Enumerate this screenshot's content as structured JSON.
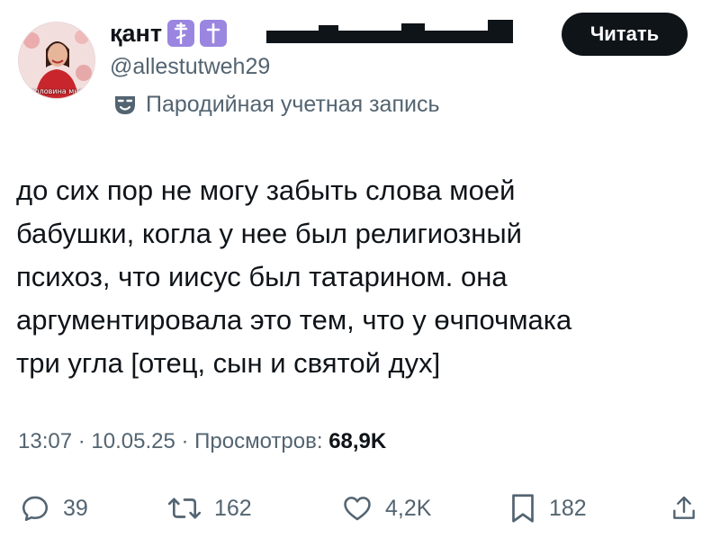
{
  "author": {
    "display_name": "қант",
    "handle": "@allestutweh29",
    "avatar_caption": "половина мне",
    "badge_icons": [
      "orthodox-cross-icon",
      "latin-cross-icon"
    ]
  },
  "parody_label": "Пародийная учетная запись",
  "follow_button": "Читать",
  "tweet": {
    "text": "до сих пор не могу забыть слова моей\nбабушки, когла у нее был религиозный\nпсихоз, что иисус был татарином. она\nаргументировала это тем, что у өчпочмака\nтри угла [отец, сын и святой дух]"
  },
  "meta": {
    "time": "13:07",
    "separator": " · ",
    "date": "10.05.25",
    "views_label": "Просмотров:",
    "views_value": "68,9K"
  },
  "actions": {
    "replies": "39",
    "reposts": "162",
    "likes": "4,2K",
    "bookmarks": "182"
  },
  "colors": {
    "text_primary": "#0f1419",
    "text_secondary": "#536471",
    "button_bg": "#0f1419",
    "emoji_bg": "#9a86e0"
  }
}
